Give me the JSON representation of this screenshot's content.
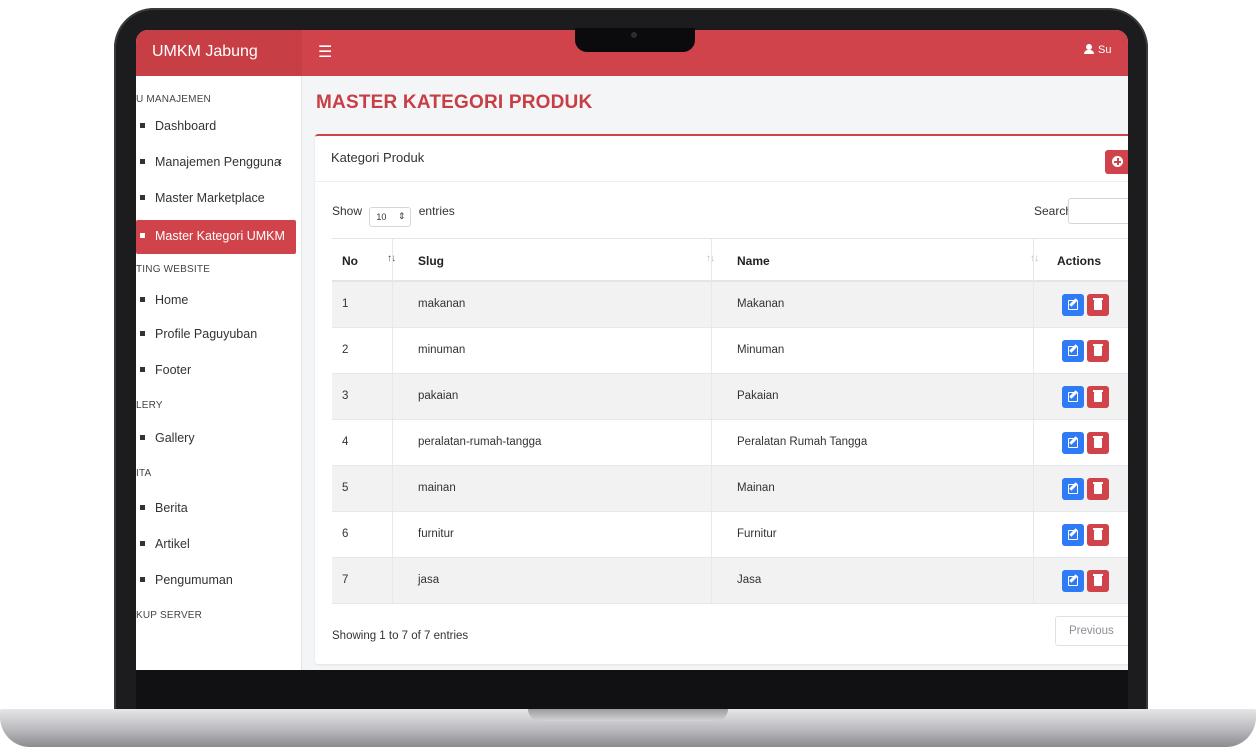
{
  "app": {
    "brand": "UMKM Jabung",
    "menu_icon": "hamburger-icon",
    "user_label": "Su",
    "user_icon": "user-icon",
    "accent_color": "#d0434a"
  },
  "sidebar": {
    "sections": [
      {
        "label": "U MANAJEMEN"
      },
      {
        "label": "TING WEBSITE"
      },
      {
        "label": "LERY"
      },
      {
        "label": "ITA"
      },
      {
        "label": "KUP SERVER"
      }
    ],
    "items": [
      {
        "label": "Dashboard"
      },
      {
        "label": "Manajemen Pengguna",
        "chevron": "‹"
      },
      {
        "label": "Master Marketplace"
      },
      {
        "label": "Master Kategori UMKM",
        "active": true
      },
      {
        "label": "Home"
      },
      {
        "label": "Profile Paguyuban"
      },
      {
        "label": "Footer"
      },
      {
        "label": "Gallery"
      },
      {
        "label": "Berita"
      },
      {
        "label": "Artikel"
      },
      {
        "label": "Pengumuman"
      }
    ]
  },
  "page": {
    "title": "MASTER KATEGORI PRODUK",
    "card_title": "Kategori Produk",
    "add_icon": "plus-circle-icon"
  },
  "table_controls": {
    "show_label": "Show",
    "page_length": "10",
    "entries_label": "entries",
    "search_label": "Search:",
    "search_value": ""
  },
  "table": {
    "columns": [
      "No",
      "Slug",
      "Name",
      "Actions"
    ],
    "rows": [
      {
        "no": "1",
        "slug": "makanan",
        "name": "Makanan"
      },
      {
        "no": "2",
        "slug": "minuman",
        "name": "Minuman"
      },
      {
        "no": "3",
        "slug": "pakaian",
        "name": "Pakaian"
      },
      {
        "no": "4",
        "slug": "peralatan-rumah-tangga",
        "name": "Peralatan Rumah Tangga"
      },
      {
        "no": "5",
        "slug": "mainan",
        "name": "Mainan"
      },
      {
        "no": "6",
        "slug": "furnitur",
        "name": "Furnitur"
      },
      {
        "no": "7",
        "slug": "jasa",
        "name": "Jasa"
      }
    ],
    "edit_icon": "edit-icon",
    "delete_icon": "trash-icon"
  },
  "pagination": {
    "info": "Showing 1 to 7 of 7 entries",
    "previous_label": "Previous"
  }
}
